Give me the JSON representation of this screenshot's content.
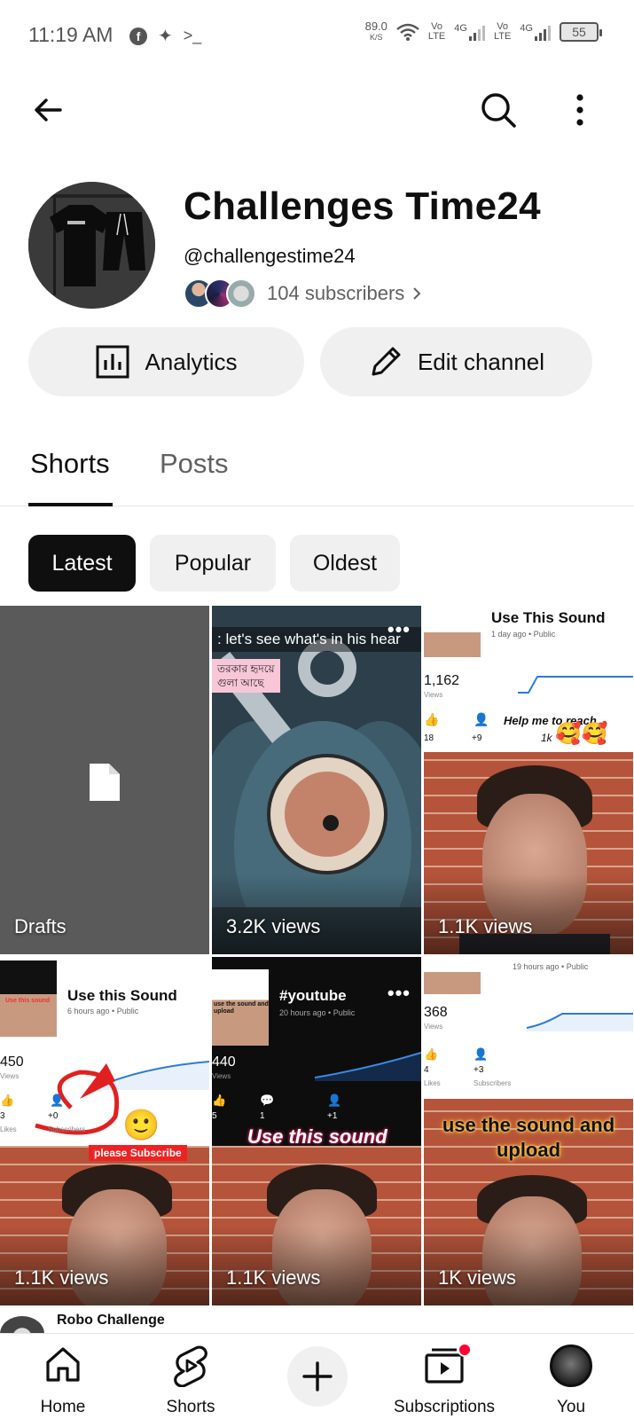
{
  "status_bar": {
    "time": "11:19 AM",
    "net_speed": "89.0",
    "net_unit": "K/S",
    "network_1": "4G",
    "network_2": "4G",
    "vo_label": "Vo",
    "lte_label": "LTE",
    "battery": "55"
  },
  "channel": {
    "name": "Challenges Time24",
    "handle": "@challengestime24",
    "subscribers": "104 subscribers"
  },
  "actions": {
    "analytics_label": "Analytics",
    "edit_label": "Edit channel"
  },
  "tabs": [
    {
      "label": "Shorts",
      "active": true
    },
    {
      "label": "Posts",
      "active": false
    }
  ],
  "chips": [
    {
      "label": "Latest",
      "active": true
    },
    {
      "label": "Popular",
      "active": false
    },
    {
      "label": "Oldest",
      "active": false
    }
  ],
  "grid": [
    {
      "label": "Drafts"
    },
    {
      "views": "3.2K views",
      "overlay_text": ": let's see what's in his hear",
      "bn_line1": "তরকার হৃদয়ে",
      "bn_line2": "গুলা আছে"
    },
    {
      "views": "1.1K views",
      "card_title": "Use This Sound",
      "card_meta": "1 day ago • Public",
      "card_count": "1,162",
      "card_count_label": "Views",
      "likes": "18",
      "subs": "+9",
      "help_text": "Help me to reach",
      "target": "1k"
    },
    {
      "views": "1.1K views",
      "card_title": "Use this Sound",
      "card_meta": "6 hours ago • Public",
      "card_count": "450",
      "card_count_label": "Views",
      "likes": "3",
      "subs": "+0",
      "likes_label": "Likes",
      "subs_label": "Subscribers",
      "banner": "please Subscribe",
      "mini_title": "Use this sound"
    },
    {
      "views": "1.1K views",
      "card_title": "#youtube",
      "card_meta": "20 hours ago • Public",
      "card_count": "440",
      "card_count_label": "Views",
      "likes": "5",
      "comments": "1",
      "subs": "+1",
      "overlay_text": "Use this sound",
      "mini_title": "use the sound and upload"
    },
    {
      "views": "1K views",
      "card_meta": "19 hours ago • Public",
      "card_count": "368",
      "card_count_label": "Views",
      "likes": "4",
      "subs": "+3",
      "likes_label": "Likes",
      "subs_label": "Subscribers",
      "overlay_line1": "use the sound and",
      "overlay_line2": "upload"
    }
  ],
  "peek": {
    "title": "Robo Challenge"
  },
  "bottom_nav": [
    {
      "label": "Home",
      "icon": "home-icon"
    },
    {
      "label": "Shorts",
      "icon": "shorts-icon"
    },
    {
      "label": "",
      "icon": "create-icon"
    },
    {
      "label": "Subscriptions",
      "icon": "subscriptions-icon"
    },
    {
      "label": "You",
      "icon": "avatar"
    }
  ],
  "colors": {
    "accent": "#0f0f0f",
    "chip_bg": "#f0f0f0",
    "notification_dot": "#ff0033",
    "drafts_tile": "#5a5a5a"
  }
}
